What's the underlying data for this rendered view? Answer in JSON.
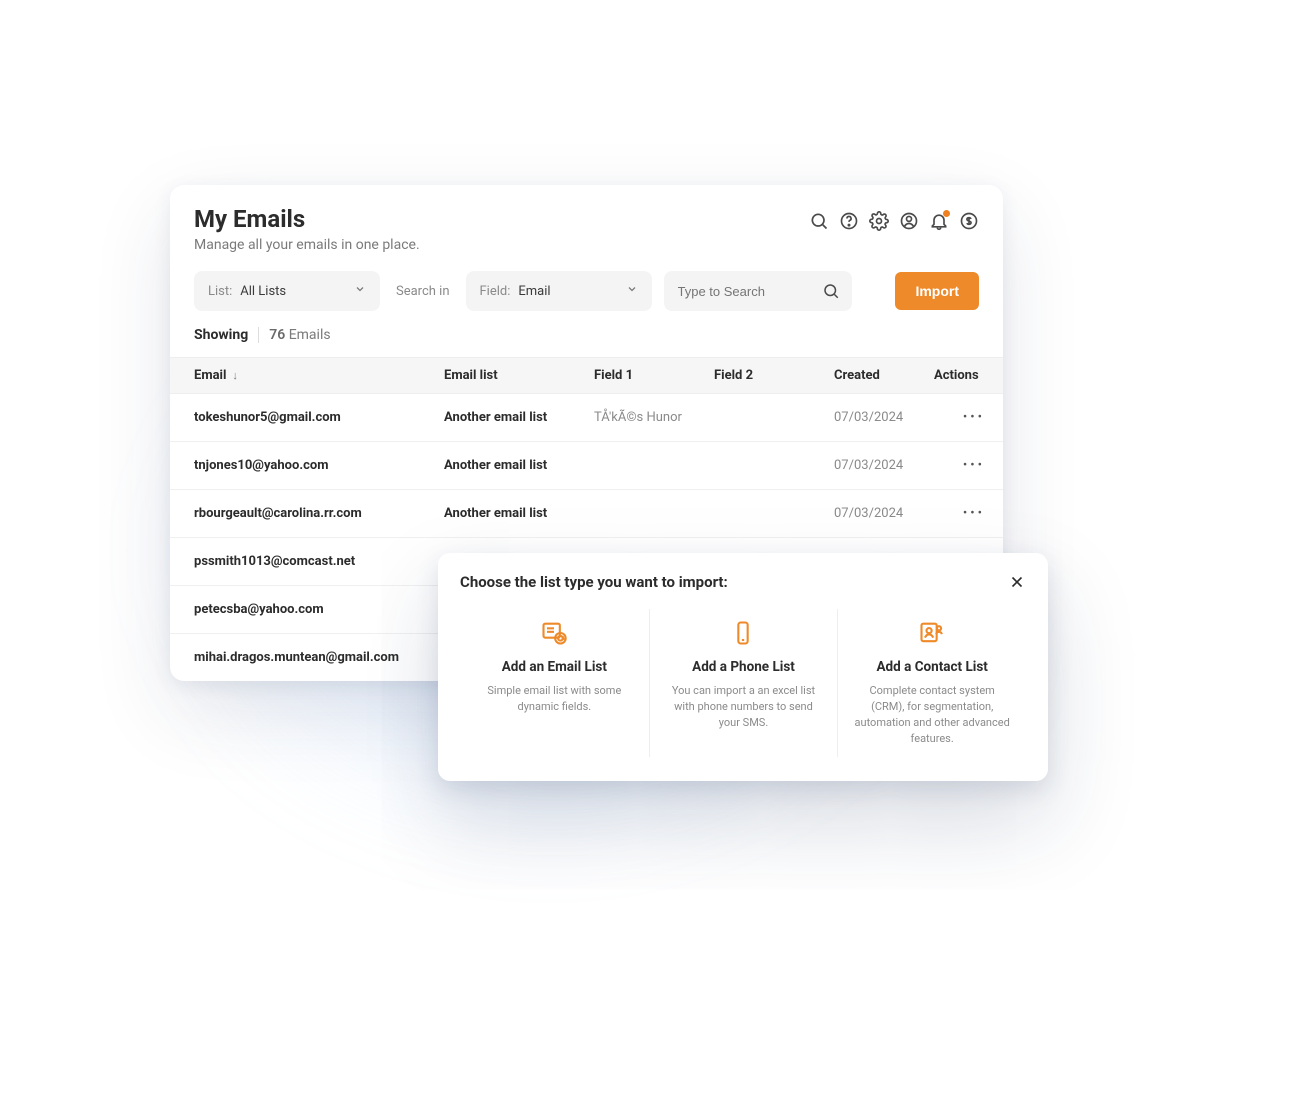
{
  "header": {
    "title": "My Emails",
    "subtitle": "Manage all your emails in one place."
  },
  "filters": {
    "list_label": "List:",
    "list_value": "All Lists",
    "search_in_label": "Search in",
    "field_label": "Field:",
    "field_value": "Email",
    "search_placeholder": "Type to Search",
    "import_label": "Import"
  },
  "showing": {
    "label": "Showing",
    "count": "76",
    "unit": "Emails"
  },
  "columns": {
    "email": "Email",
    "email_list": "Email list",
    "field1": "Field 1",
    "field2": "Field 2",
    "created": "Created",
    "actions": "Actions"
  },
  "rows": [
    {
      "email": "tokeshunor5@gmail.com",
      "list": "Another email list",
      "f1": "TÅ'kÃ©s Hunor",
      "f2": "",
      "created": "07/03/2024"
    },
    {
      "email": "tnjones10@yahoo.com",
      "list": "Another email list",
      "f1": "",
      "f2": "",
      "created": "07/03/2024"
    },
    {
      "email": "rbourgeault@carolina.rr.com",
      "list": "Another email list",
      "f1": "",
      "f2": "",
      "created": "07/03/2024"
    },
    {
      "email": "pssmith1013@comcast.net",
      "list": "",
      "f1": "",
      "f2": "",
      "created": ""
    },
    {
      "email": "petecsba@yahoo.com",
      "list": "",
      "f1": "",
      "f2": "",
      "created": ""
    },
    {
      "email": "mihai.dragos.muntean@gmail.com",
      "list": "",
      "f1": "",
      "f2": "",
      "created": ""
    }
  ],
  "modal": {
    "title": "Choose the list type you want to import:",
    "options": [
      {
        "title": "Add an Email List",
        "desc": "Simple email list with some dynamic fields."
      },
      {
        "title": "Add a Phone List",
        "desc": "You can import a an excel list with phone numbers to send your SMS."
      },
      {
        "title": "Add a Contact List",
        "desc": "Complete contact system (CRM), for segmentation, automation and other advanced features."
      }
    ]
  }
}
